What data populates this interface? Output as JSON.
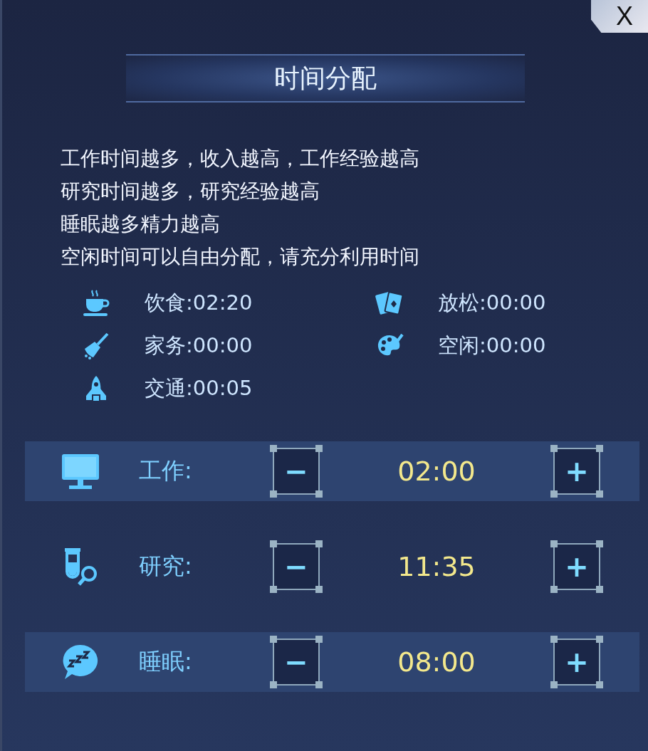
{
  "dialog": {
    "title": "时间分配",
    "close": "X"
  },
  "description": [
    "工作时间越多，收入越高，工作经验越高",
    "研究时间越多，研究经验越高",
    "睡眠越多精力越高",
    "空闲时间可以自由分配，请充分利用时间"
  ],
  "stats": [
    {
      "kind": "cup",
      "label": "饮食:02:20"
    },
    {
      "kind": "cards",
      "label": "放松:00:00"
    },
    {
      "kind": "broom",
      "label": "家务:00:00"
    },
    {
      "kind": "palette",
      "label": "空闲:00:00"
    },
    {
      "kind": "rocket",
      "label": "交通:00:05"
    }
  ],
  "allocations": [
    {
      "kind": "monitor",
      "label": "工作:",
      "minus": "−",
      "value": "02:00",
      "plus": "+"
    },
    {
      "kind": "flask",
      "label": "研究:",
      "minus": "−",
      "value": "11:35",
      "plus": "+"
    },
    {
      "kind": "sleep",
      "label": "睡眠:",
      "minus": "−",
      "value": "08:00",
      "plus": "+"
    }
  ]
}
